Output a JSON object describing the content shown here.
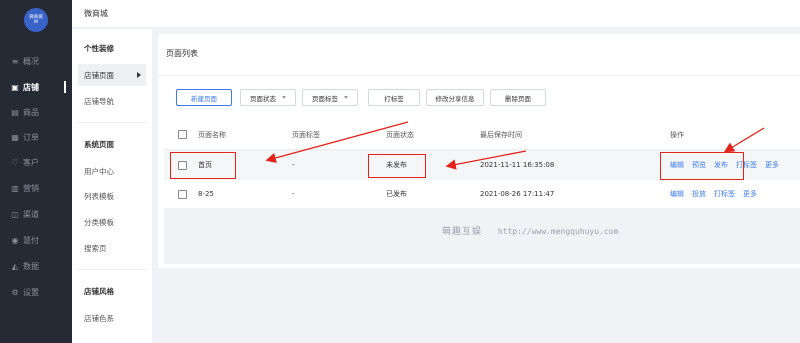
{
  "sidebar": {
    "logo_line1": "微商城",
    "logo_line2": "W",
    "items": [
      {
        "label": "概况",
        "icon": "list-icon"
      },
      {
        "label": "店铺",
        "icon": "shop-icon"
      },
      {
        "label": "商品",
        "icon": "goods-icon"
      },
      {
        "label": "订单",
        "icon": "order-icon"
      },
      {
        "label": "客户",
        "icon": "heart-icon"
      },
      {
        "label": "营销",
        "icon": "chart-icon"
      },
      {
        "label": "渠道",
        "icon": "channel-icon"
      },
      {
        "label": "慧付",
        "icon": "pay-icon"
      },
      {
        "label": "数据",
        "icon": "data-icon"
      },
      {
        "label": "设置",
        "icon": "gear-icon"
      }
    ]
  },
  "header": {
    "title": "微商城"
  },
  "submenu": {
    "group1": "个性装修",
    "item_shop_page": "店铺页面",
    "item_shop_nav": "店铺导航",
    "group2": "系统页面",
    "item_user_center": "用户中心",
    "item_list_tpl": "列表模板",
    "item_category_tpl": "分类模板",
    "item_search": "搜索页",
    "group3": "店铺风格",
    "item_color": "店铺色系"
  },
  "main": {
    "title": "页面列表",
    "toolbar": {
      "new_page": "新建页面",
      "page_status": "页面状态",
      "page_tag": "页面标签",
      "tag": "打标签",
      "edit_share": "修改分享信息",
      "delete_page": "删除页面"
    },
    "columns": {
      "name": "页面名称",
      "tag": "页面标签",
      "status": "页面状态",
      "saved_at": "最后保存时间",
      "actions": "操作"
    },
    "rows": [
      {
        "name": "首页",
        "tag": "-",
        "status": "未发布",
        "saved_at": "2021-11-11 16:35:08",
        "a1": "编辑",
        "a2": "预览",
        "a3": "发布",
        "a4": "打标签",
        "a5": "更多"
      },
      {
        "name": "8-25",
        "tag": "-",
        "status": "已发布",
        "saved_at": "2021-08-26 17:11:47",
        "a1": "编辑",
        "a2": "投放",
        "a3": "打标签",
        "a4": "更多"
      }
    ]
  },
  "watermark": {
    "brand": "萌趣互娱",
    "url": "http://www.mengquhuyu.com"
  },
  "colors": {
    "accent": "#3a7bef",
    "highlight": "#e2231a",
    "sidebar": "#262a35"
  }
}
